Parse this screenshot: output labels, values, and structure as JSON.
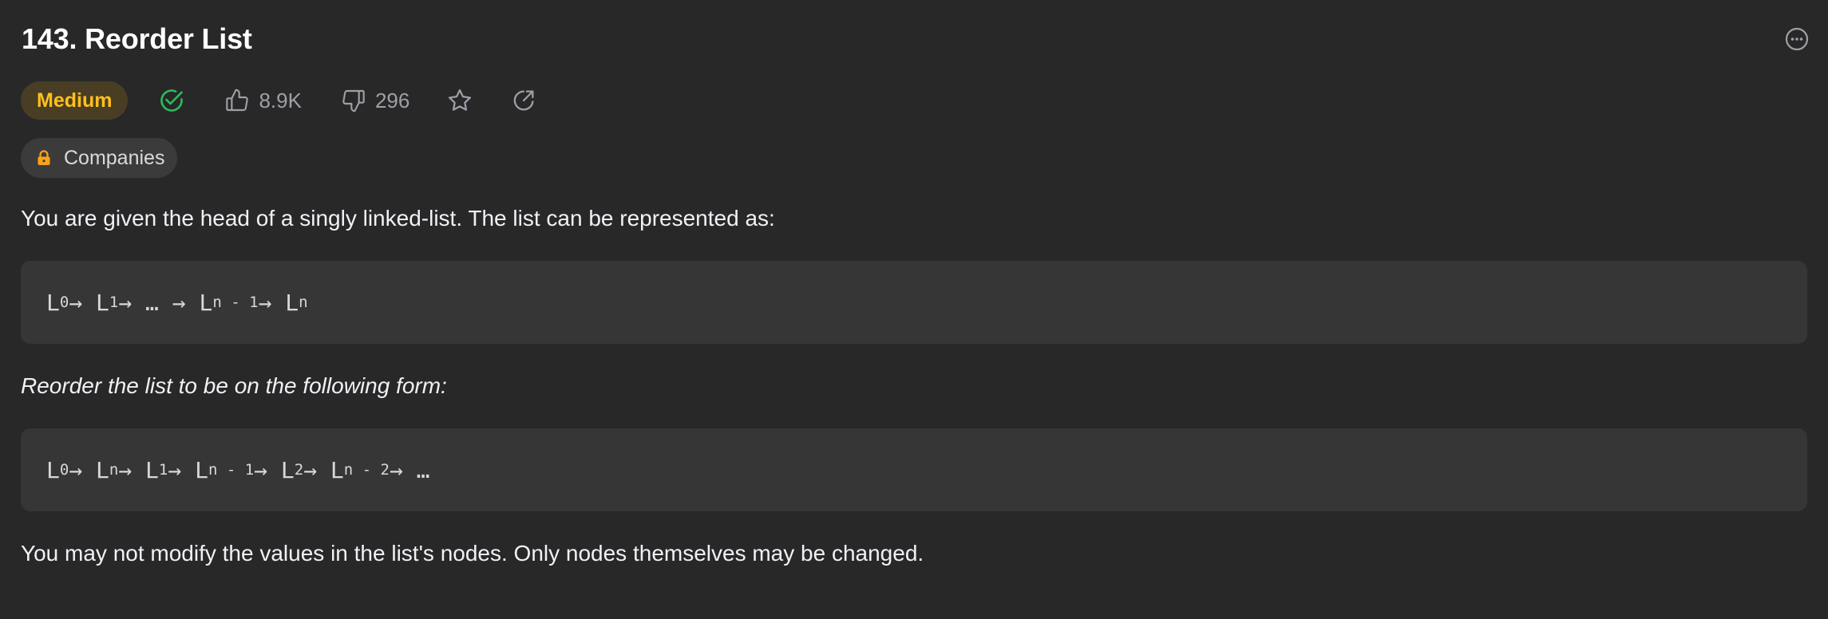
{
  "problem": {
    "title": "143. Reorder List",
    "difficulty": "Medium",
    "likes": "8.9K",
    "dislikes": "296",
    "companies_label": "Companies"
  },
  "description": {
    "intro": "You are given the head of a singly linked-list. The list can be represented as:",
    "code1": [
      {
        "t": "L",
        "s": "0"
      },
      {
        "t": " → L",
        "s": "1"
      },
      {
        "t": " → … → L",
        "s": "n - 1"
      },
      {
        "t": " → L",
        "s": "n"
      }
    ],
    "instruction": "Reorder the list to be on the following form:",
    "code2": [
      {
        "t": "L",
        "s": "0"
      },
      {
        "t": " → L",
        "s": "n"
      },
      {
        "t": " → L",
        "s": "1"
      },
      {
        "t": " → L",
        "s": "n - 1"
      },
      {
        "t": " → L",
        "s": "2"
      },
      {
        "t": " → L",
        "s": "n - 2"
      },
      {
        "t": " → …",
        "s": ""
      }
    ],
    "constraint": "You may not modify the values in the list's nodes. Only nodes themselves may be changed."
  },
  "colors": {
    "background": "#282828",
    "medium_text": "#ffc01e",
    "medium_bg": "#493e24",
    "solved_green": "#2cbb5d",
    "lock_orange": "#ffa116",
    "muted_icon": "#9da0a6"
  },
  "icons": {
    "more": "more-horizontal-circle-icon",
    "solved": "check-circle-icon",
    "like": "thumbs-up-icon",
    "dislike": "thumbs-down-icon",
    "favorite": "star-icon",
    "share": "share-icon",
    "lock": "lock-icon"
  }
}
